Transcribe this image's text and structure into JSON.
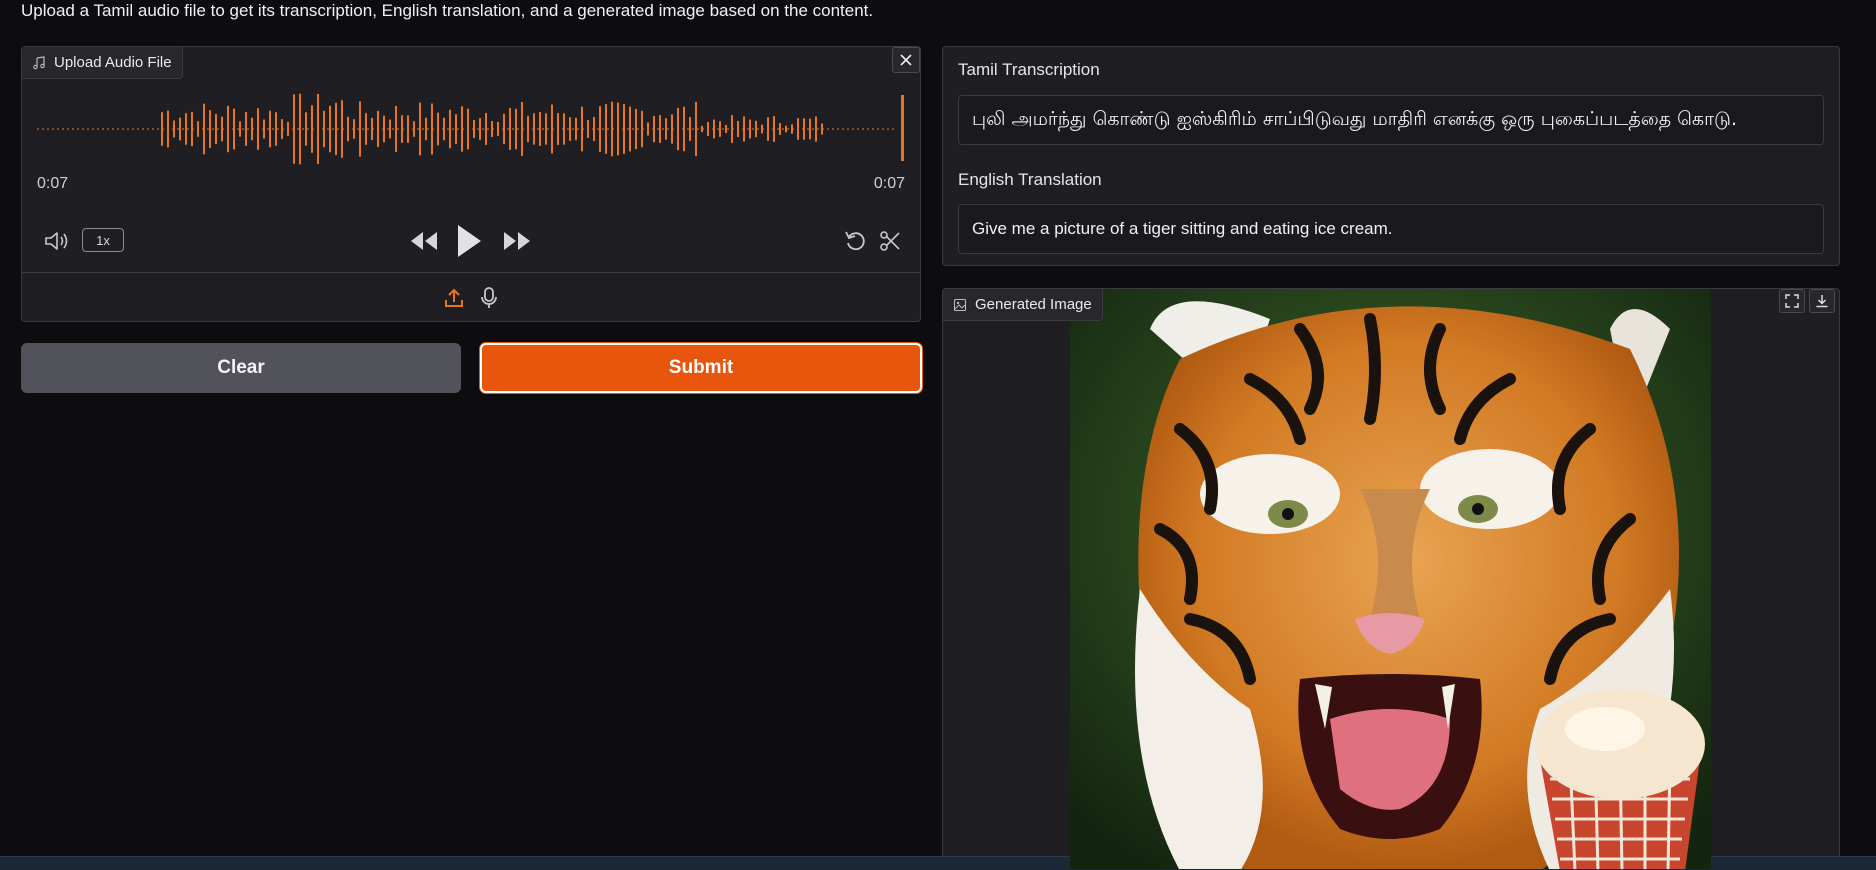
{
  "description": "Upload a Tamil audio file to get its transcription, English translation, and a generated image based on the content.",
  "audio": {
    "label": "Upload Audio File",
    "current_time": "0:07",
    "duration": "0:07",
    "speed": "1x",
    "accent_color": "#e8761d"
  },
  "buttons": {
    "clear": "Clear",
    "submit": "Submit"
  },
  "transcription": {
    "label": "Tamil Transcription",
    "value": "புலி அமர்ந்து கொண்டு ஐஸ்கிரிம் சாப்பிடுவது மாதிரி எனக்கு ஒரு புகைப்படத்தை கொடு."
  },
  "translation": {
    "label": "English Translation",
    "value": "Give me a picture of a tiger sitting and eating ice cream."
  },
  "image": {
    "label": "Generated Image"
  },
  "colors": {
    "primary": "#e8550d",
    "secondary": "#52525b",
    "background": "#0d0d10",
    "panel": "#1f1f23"
  }
}
